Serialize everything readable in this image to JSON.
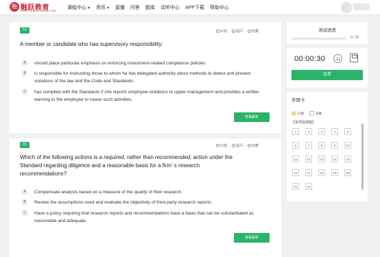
{
  "header": {
    "logo_mark": "融",
    "logo_text": "融跃教育",
    "logo_subtext": "RONGYUEDUCATION.COM",
    "nav": [
      {
        "label": "课程中心",
        "has_caret": true
      },
      {
        "label": "资讯",
        "has_caret": true
      },
      {
        "label": "直播",
        "has_caret": false
      },
      {
        "label": "问答",
        "has_caret": false
      },
      {
        "label": "题库",
        "has_caret": false
      },
      {
        "label": "试听中心",
        "has_caret": false
      },
      {
        "label": "APP下载",
        "has_caret": false
      },
      {
        "label": "帮助中心",
        "has_caret": false
      }
    ],
    "caret_glyph": "▼"
  },
  "questions": [
    {
      "number": "14",
      "tools": [
        "纠错",
        "提问",
        "收藏"
      ],
      "stem_parts": [
        "A member or candidate who has supervisory responsibility:"
      ],
      "options": [
        {
          "letter": "A",
          "text": "should place particular emphasis on enforcing investment-related compliance policies."
        },
        {
          "letter": "B",
          "text": "is responsible for instructing those to whom he has delegated authority about methods to detect and prevent violations of the law and the Code and Standards."
        },
        {
          "letter": "C",
          "text": "has complied with the Standards if she reports employee violations to upper management and provides a written warning to the employee to cease such activities."
        }
      ],
      "answer_button": "查看解析"
    },
    {
      "number": "15",
      "tools": [
        "纠错",
        "提问",
        "收藏"
      ],
      "stem_parts": [
        "Which of the following actions is a ",
        "required,",
        " rather than ",
        "recommended,",
        " action under the Standard regarding diligence and a reasonable basis for a firm’ s research recommendations?"
      ],
      "options": [
        {
          "letter": "A",
          "text": "Compensate analysts based on a measure of the quality of their research."
        },
        {
          "letter": "B",
          "text": "Review the assumptions used and evaluate the objectivity of third-party research reports."
        },
        {
          "letter": "C",
          "text": "Have a policy requiring that research reports and recommendations have a basis that can be substantiated as reasonable and adequate."
        }
      ],
      "answer_button": "查看解析"
    }
  ],
  "progress": {
    "title": "测试进度",
    "count_text": "0 / 22",
    "value": 0
  },
  "timer": {
    "time": "00:00:30",
    "submit_label": "交卷"
  },
  "answer_sheet": {
    "title": "答题卡",
    "legend_done": "已做",
    "legend_undone": "未做",
    "section_label": "【单项选择题】",
    "numbers": [
      "1",
      "2",
      "3",
      "4",
      "5",
      "6",
      "7",
      "8",
      "9",
      "10",
      "11",
      "12",
      "13",
      "14",
      "15",
      "16",
      "17",
      "18",
      "19",
      "20",
      "21",
      "22"
    ]
  }
}
